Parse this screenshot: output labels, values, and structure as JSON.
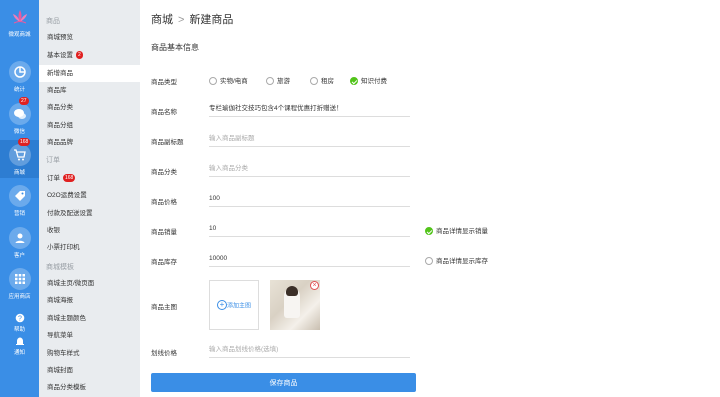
{
  "app": {
    "name": "微观商城"
  },
  "rail": {
    "items": [
      {
        "label": "统计",
        "icon": "chart-icon"
      },
      {
        "label": "微信",
        "icon": "wechat-icon",
        "badge": "27"
      },
      {
        "label": "商城",
        "icon": "cart-icon",
        "badge": "168"
      },
      {
        "label": "营销",
        "icon": "tag-icon"
      },
      {
        "label": "客户",
        "icon": "users-icon"
      },
      {
        "label": "应用商店",
        "icon": "grid-icon"
      },
      {
        "label": "帮助",
        "icon": "help-icon"
      },
      {
        "label": "通知",
        "icon": "bell-icon"
      }
    ]
  },
  "submenu": {
    "groups": [
      {
        "title": "商品",
        "items": [
          {
            "label": "商城预览"
          },
          {
            "label": "基本设置",
            "badge": "2"
          },
          {
            "label": "新增商品",
            "active": true
          },
          {
            "label": "商品库"
          },
          {
            "label": "商品分类"
          },
          {
            "label": "商品分组"
          },
          {
            "label": "商品品牌"
          }
        ]
      },
      {
        "title": "订单",
        "items": [
          {
            "label": "订单",
            "badge": "168"
          },
          {
            "label": "O2O运费设置"
          },
          {
            "label": "付款及配送设置"
          },
          {
            "label": "收银"
          },
          {
            "label": "小票打印机"
          }
        ]
      },
      {
        "title": "商城模板",
        "items": [
          {
            "label": "商城主页/微页面"
          },
          {
            "label": "商城海报"
          },
          {
            "label": "商城主题颜色"
          },
          {
            "label": "导航菜单"
          },
          {
            "label": "购物车样式"
          },
          {
            "label": "商城封面"
          },
          {
            "label": "商品分类模板"
          }
        ]
      }
    ]
  },
  "breadcrumb": {
    "root": "商城",
    "separator": ">",
    "current": "新建商品"
  },
  "form": {
    "section_title": "商品基本信息",
    "type": {
      "label": "商品类型",
      "options": [
        {
          "label": "实物/电商",
          "selected": false
        },
        {
          "label": "旅游",
          "selected": false
        },
        {
          "label": "租房",
          "selected": false
        },
        {
          "label": "知识付费",
          "selected": true
        }
      ]
    },
    "name": {
      "label": "商品名称",
      "value": "专栏瑜伽社交技巧包含4个课程优惠打折赠送！"
    },
    "subtitle": {
      "label": "商品副标题",
      "placeholder": "输入商品副标题"
    },
    "category": {
      "label": "商品分类",
      "placeholder": "输入商品分类"
    },
    "price": {
      "label": "商品价格",
      "value": "100"
    },
    "sales": {
      "label": "商品销量",
      "value": "10",
      "toggle_label": "商品详情显示销量",
      "toggle_on": true
    },
    "stock": {
      "label": "商品库存",
      "value": "10000",
      "toggle_label": "商品详情显示库存",
      "toggle_on": false
    },
    "main_image": {
      "label": "商品主图",
      "add_label": "添加主图",
      "close_glyph": "×"
    },
    "strike_price": {
      "label": "划线价格",
      "placeholder": "输入商品划线价格(选填)"
    },
    "submit_label": "保存商品"
  },
  "colors": {
    "primary": "#3a8ee6",
    "rail_bg": "#3a8ee6",
    "submenu_bg": "#e9ecef",
    "success": "#52c41a",
    "badge": "#e02020"
  }
}
